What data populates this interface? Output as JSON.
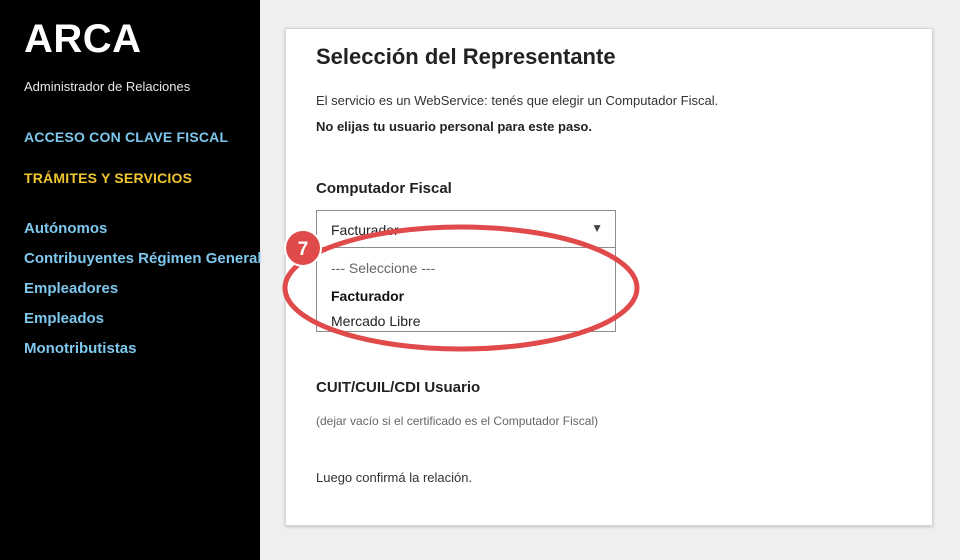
{
  "sidebar": {
    "logo": "ARCA",
    "subtitle": "Administrador de Relaciones",
    "access_link": "ACCESO CON CLAVE FISCAL",
    "tramites_link": "TRÁMITES Y SERVICIOS",
    "items": [
      {
        "label": "Autónomos"
      },
      {
        "label": "Contribuyentes Régimen General"
      },
      {
        "label": "Empleadores"
      },
      {
        "label": "Empleados"
      },
      {
        "label": "Monotributistas"
      }
    ]
  },
  "card": {
    "title": "Selección del Representante",
    "info": "El servicio es un WebService: tenés que elegir un Computador Fiscal.",
    "warning": "No elijas tu usuario personal para este paso.",
    "computador_label": "Computador Fiscal",
    "select": {
      "value": "Facturador",
      "options": [
        "--- Seleccione ---",
        "Facturador",
        "Mercado Libre"
      ]
    },
    "cuit_label": "CUIT/CUIL/CDI Usuario",
    "cuit_hint": "(dejar vacío si el certificado es el Computador Fiscal)",
    "confirm_text": "Luego confirmá la relación."
  },
  "annotation": {
    "step": "7",
    "color": "#e14a4a"
  },
  "icons": {
    "select_caret": "caret-down-icon"
  }
}
